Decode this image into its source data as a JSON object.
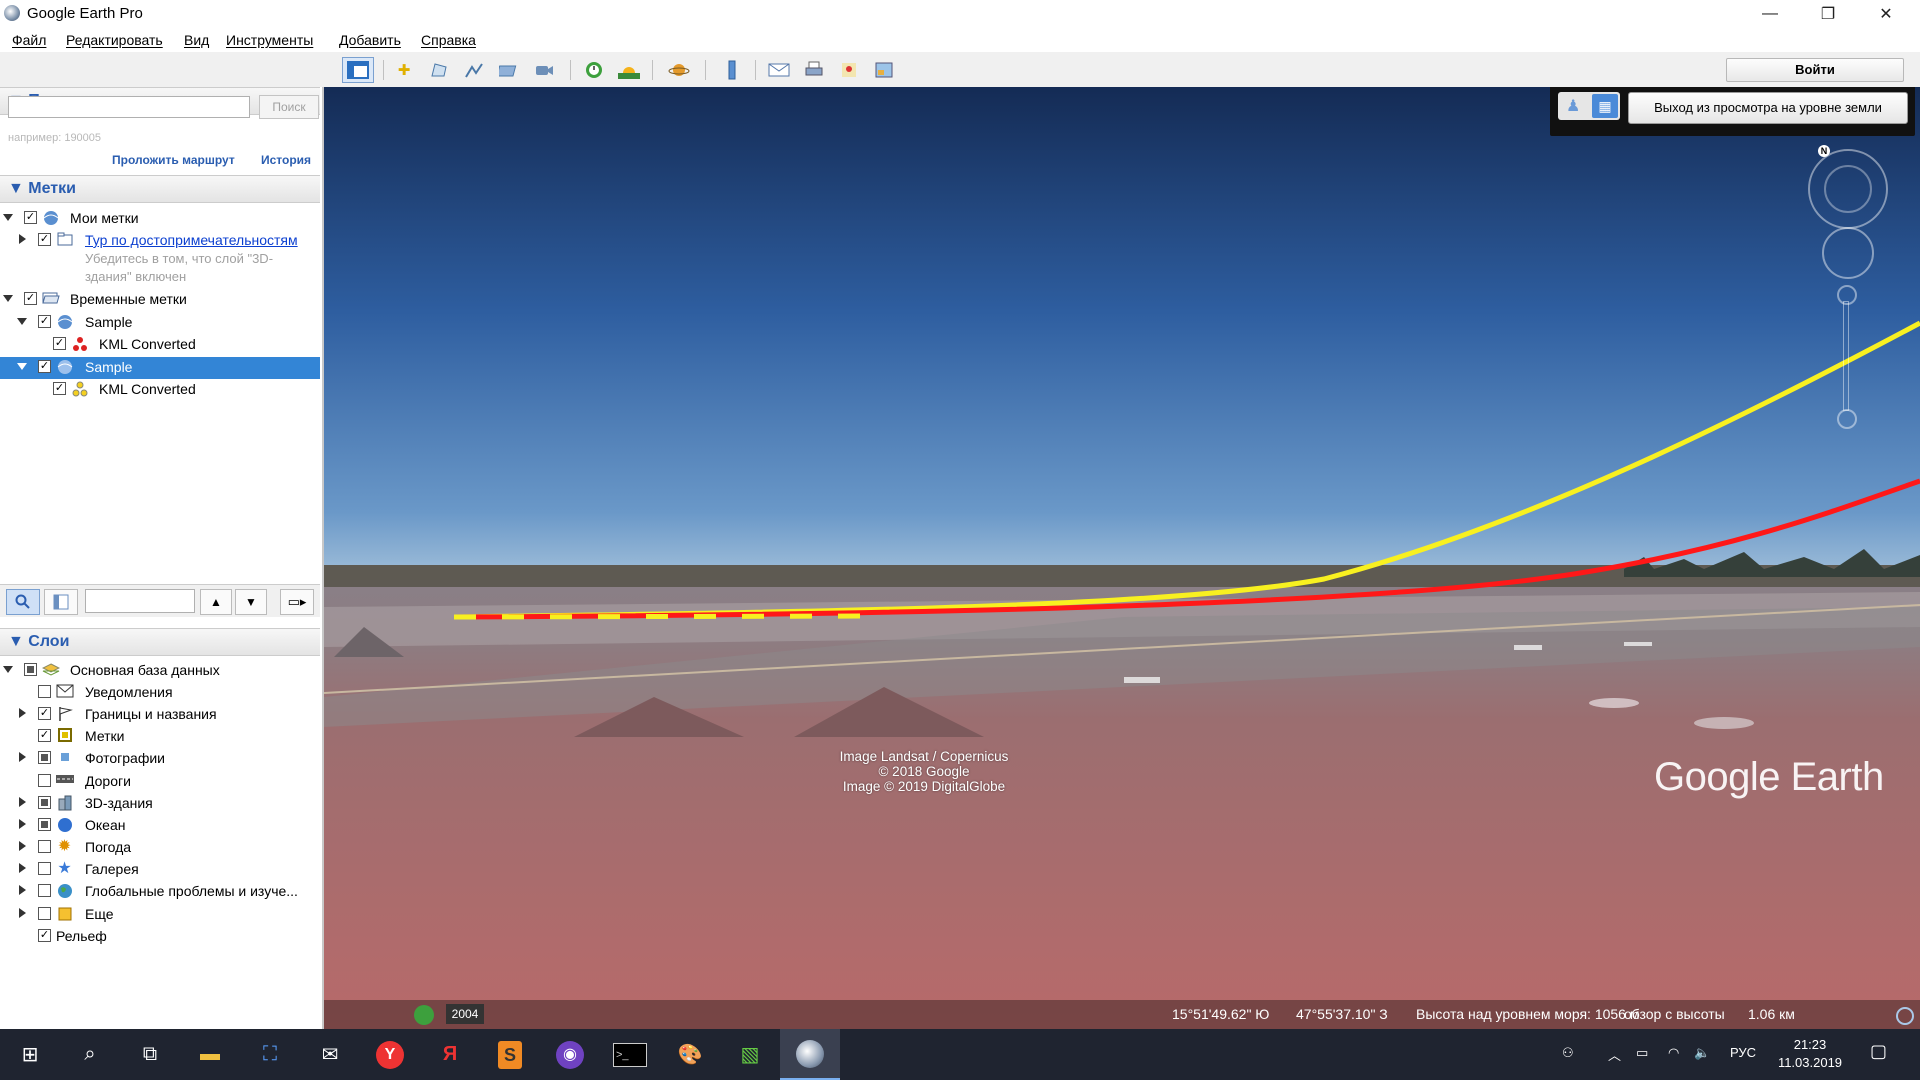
{
  "window": {
    "title": "Google Earth Pro",
    "minimize": "—",
    "restore": "❐",
    "close": "✕"
  },
  "menu": [
    "Файл",
    "Редактировать",
    "Вид",
    "Инструменты",
    "Добавить",
    "Справка"
  ],
  "toolbar": {
    "icons": [
      "sidebar-toggle-icon",
      "placemark-icon",
      "polygon-icon",
      "path-icon",
      "image-overlay-icon",
      "record-tour-icon",
      "historical-imagery-icon",
      "sunlight-icon",
      "planets-icon",
      "ruler-icon",
      "email-icon",
      "print-icon",
      "google-maps-icon",
      "save-image-icon"
    ],
    "login_label": "Войти"
  },
  "search": {
    "header": "Поиск",
    "input_value": "",
    "button_label": "Поиск",
    "hint": "например: 190005",
    "route_link": "Проложить маршрут",
    "history_link": "История"
  },
  "places": {
    "header": "Метки",
    "items": [
      {
        "label": "Мои метки",
        "icon": "globe-icon",
        "checked": true
      },
      {
        "label": "Тур по достопримечательностям",
        "icon": "folder-icon",
        "checked": true,
        "link": true
      },
      {
        "label": "Убедитесь в том, что слой \"3D-",
        "note": true
      },
      {
        "label": "здания\" включен",
        "note": true
      },
      {
        "label": "Временные метки",
        "icon": "folder-open-icon",
        "checked": true
      },
      {
        "label": "Sample",
        "icon": "globe-icon",
        "checked": true
      },
      {
        "label": "KML Converted",
        "icon": "kml-red-icon",
        "checked": true
      },
      {
        "label": "Sample",
        "icon": "globe-icon",
        "checked": true,
        "selected": true
      },
      {
        "label": "KML Converted",
        "icon": "kml-yellow-icon",
        "checked": true
      }
    ]
  },
  "layers": {
    "header": "Слои",
    "items": [
      {
        "label": "Основная база данных",
        "state": "partial"
      },
      {
        "label": "Уведомления",
        "state": "off"
      },
      {
        "label": "Границы и названия",
        "state": "on"
      },
      {
        "label": "Метки",
        "state": "on"
      },
      {
        "label": "Фотографии",
        "state": "partial"
      },
      {
        "label": "Дороги",
        "state": "off"
      },
      {
        "label": "3D-здания",
        "state": "partial"
      },
      {
        "label": "Океан",
        "state": "partial"
      },
      {
        "label": "Погода",
        "state": "off"
      },
      {
        "label": "Галерея",
        "state": "off"
      },
      {
        "label": "Глобальные проблемы и изуче...",
        "state": "off"
      },
      {
        "label": "Еще",
        "state": "off"
      },
      {
        "label": "Рельеф",
        "state": "on"
      }
    ]
  },
  "map": {
    "exit_ground_label": "Выход из просмотра на уровне земли",
    "compass_north": "N",
    "attribution": [
      "Image Landsat / Copernicus",
      "© 2018 Google",
      "Image © 2019 DigitalGlobe"
    ],
    "logo": "Google Earth",
    "year": "2004",
    "status": {
      "lat": "15°51'49.62\" Ю",
      "lon": "47°55'37.10\" З",
      "elevation": "Высота над уровнем моря:  1056 м",
      "eye_alt_label": "обзор с высоты",
      "eye_alt": "1.06 км"
    },
    "path_colors": {
      "yellow": "#ffff1e",
      "red": "#ff1010"
    }
  },
  "taskbar": {
    "lang": "РУС",
    "time": "21:23",
    "date": "11.03.2019"
  }
}
